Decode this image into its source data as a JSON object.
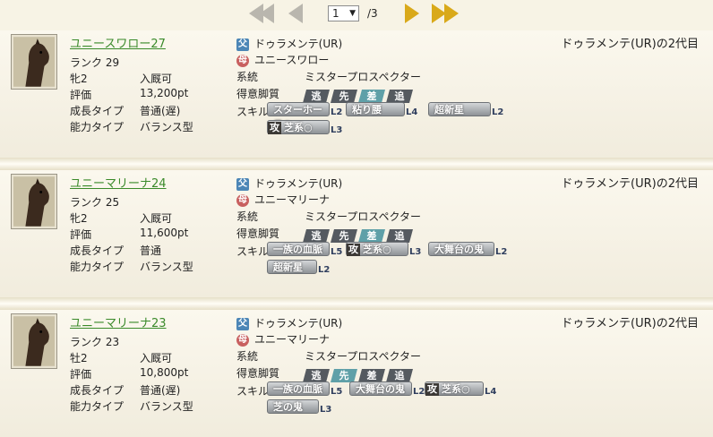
{
  "pager": {
    "current": "1",
    "total": "/3"
  },
  "cards": [
    {
      "name": "ユニースワロー27",
      "rank": "ランク 29",
      "sex_age": "牝2",
      "stable": "入厩可",
      "rating_label": "評価",
      "rating": "13,200pt",
      "growth_label": "成長タイプ",
      "growth": "普通(遅)",
      "ability_label": "能力タイプ",
      "ability": "バランス型",
      "father_badge": "父",
      "father": "ドゥラメンテ(UR)",
      "mother_badge": "母",
      "mother": "ユニースワロー",
      "lineage_label": "系統",
      "lineage": "ミスタープロスペクター",
      "style_label": "得意脚質",
      "styles": [
        "逃",
        "先",
        "差",
        "追"
      ],
      "style_on": "差",
      "skill_label": "スキル",
      "skills": [
        {
          "name": "スターホース○",
          "lv": "L2"
        },
        {
          "name": "粘り腰",
          "lv": "L4"
        },
        {
          "name": "超新星",
          "lv": "L2"
        },
        {
          "tag": "攻",
          "name": "芝系○",
          "lv": "L3"
        }
      ],
      "generation": "ドゥラメンテ(UR)の2代目"
    },
    {
      "name": "ユニーマリーナ24",
      "rank": "ランク 25",
      "sex_age": "牝2",
      "stable": "入厩可",
      "rating_label": "評価",
      "rating": "11,600pt",
      "growth_label": "成長タイプ",
      "growth": "普通",
      "ability_label": "能力タイプ",
      "ability": "バランス型",
      "father_badge": "父",
      "father": "ドゥラメンテ(UR)",
      "mother_badge": "母",
      "mother": "ユニーマリーナ",
      "lineage_label": "系統",
      "lineage": "ミスタープロスペクター",
      "style_label": "得意脚質",
      "styles": [
        "逃",
        "先",
        "差",
        "追"
      ],
      "style_on": "差",
      "skill_label": "スキル",
      "skills": [
        {
          "name": "一族の血脈",
          "lv": "L5"
        },
        {
          "tag": "攻",
          "name": "芝系○",
          "lv": "L3"
        },
        {
          "name": "大舞台の鬼",
          "lv": "L2"
        },
        {
          "name": "超新星",
          "lv": "L2"
        }
      ],
      "generation": "ドゥラメンテ(UR)の2代目"
    },
    {
      "name": "ユニーマリーナ23",
      "rank": "ランク 23",
      "sex_age": "牡2",
      "stable": "入厩可",
      "rating_label": "評価",
      "rating": "10,800pt",
      "growth_label": "成長タイプ",
      "growth": "普通(遅)",
      "ability_label": "能力タイプ",
      "ability": "バランス型",
      "father_badge": "父",
      "father": "ドゥラメンテ(UR)",
      "mother_badge": "母",
      "mother": "ユニーマリーナ",
      "lineage_label": "系統",
      "lineage": "ミスタープロスペクター",
      "style_label": "得意脚質",
      "styles": [
        "逃",
        "先",
        "差",
        "追"
      ],
      "style_on": "先",
      "skill_label": "スキル",
      "skills": [
        {
          "name": "一族の血脈",
          "lv": "L5"
        },
        {
          "name": "大舞台の鬼",
          "lv": "L2"
        },
        {
          "tag": "攻",
          "name": "芝系○",
          "lv": "L4"
        },
        {
          "name": "芝の鬼",
          "lv": "L3"
        }
      ],
      "generation": "ドゥラメンテ(UR)の2代目"
    }
  ],
  "colors": {
    "link": "#3a8a2a",
    "style_on": "#5fa0a8",
    "style_dark": "#555a60"
  }
}
